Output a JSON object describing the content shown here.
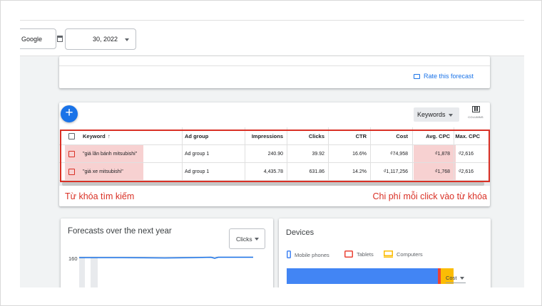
{
  "topbar": {
    "network_value": "Google",
    "date_value": "30, 2022"
  },
  "forecast_card": {
    "rate_link": "Rate this forecast"
  },
  "keywords_card": {
    "add_label": "+",
    "keywords_dropdown": "Keywords",
    "columns_label": "COLUMNS",
    "table": {
      "headers": [
        "Keyword",
        "Ad group",
        "Impressions",
        "Clicks",
        "CTR",
        "Cost",
        "Avg. CPC",
        "Max. CPC"
      ],
      "sort_indicator": "↑",
      "rows": [
        [
          "\"giá lăn bánh mitsubishi\"",
          "Ad group 1",
          "240.90",
          "39.92",
          "16.6%",
          "₫74,958",
          "₫1,878",
          "₫2,616"
        ],
        [
          "\"giá xe mitsubishi\"",
          "Ad group 1",
          "4,435.78",
          "631.86",
          "14.2%",
          "₫1,117,256",
          "₫1,768",
          "₫2,616"
        ]
      ]
    },
    "annotation_left": "Từ khóa tìm kiếm",
    "annotation_right": "Chi phí mỗi click vào từ khóa",
    "highlight_color": "#f7d1d1",
    "annotation_color": "#d93025"
  },
  "forecasts_card": {
    "title": "Forecasts over the next year",
    "metric_dropdown": "Clicks",
    "y_tick": "160"
  },
  "devices_card": {
    "title": "Devices",
    "legend": [
      {
        "label": "Mobile phones",
        "color": "#4285f4"
      },
      {
        "label": "Tablets",
        "color": "#ea4335"
      },
      {
        "label": "Computers",
        "color": "#fbbc04"
      }
    ],
    "shares": [
      0.83,
      0.015,
      0.07
    ],
    "metric_dropdown": "Cost"
  }
}
